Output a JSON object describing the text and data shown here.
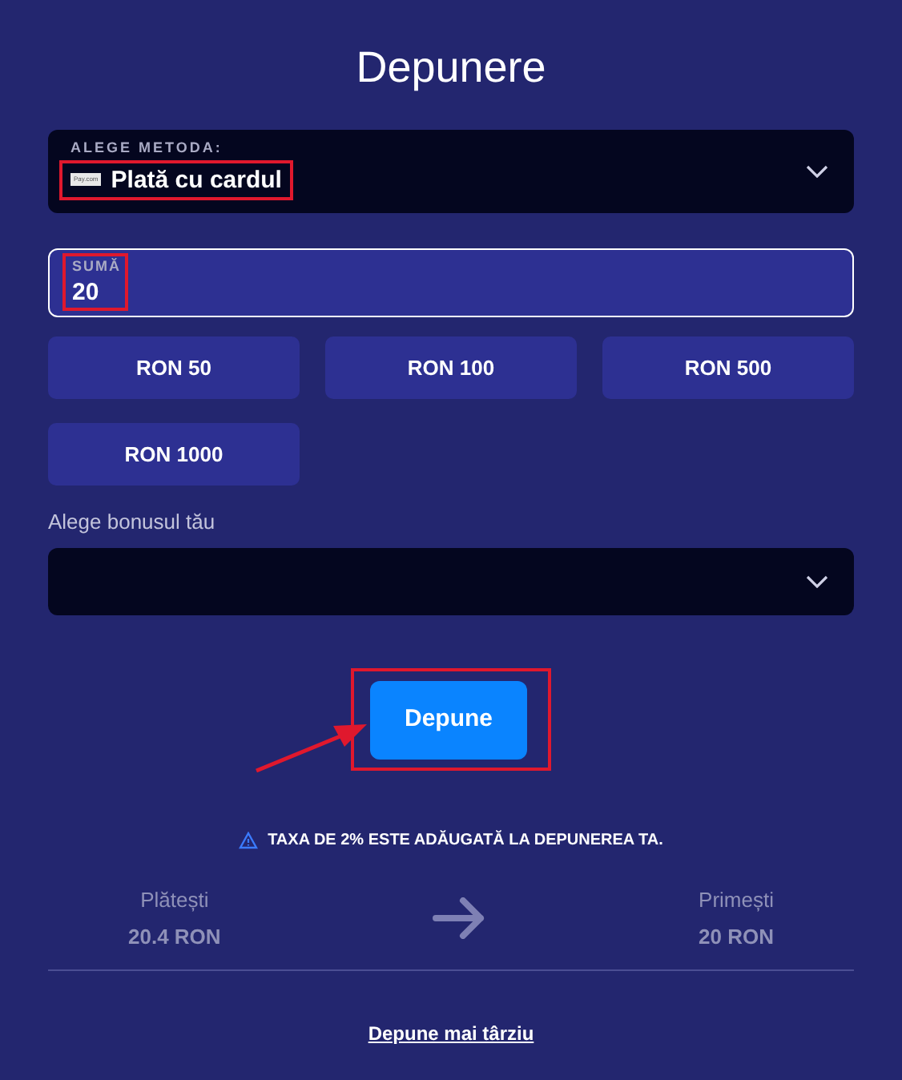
{
  "title": "Depunere",
  "method": {
    "label": "ALEGE METODA:",
    "logo": "Pay.com",
    "value": "Plată cu cardul"
  },
  "amount": {
    "label": "SUMĂ",
    "value": "20"
  },
  "presets": [
    {
      "label": "RON 50"
    },
    {
      "label": "RON 100"
    },
    {
      "label": "RON 500"
    },
    {
      "label": "RON 1000"
    }
  ],
  "bonus": {
    "label": "Alege bonusul tău"
  },
  "submit": "Depune",
  "notice": "TAXA DE 2% ESTE ADĂUGATĂ LA DEPUNEREA TA.",
  "summary": [
    {
      "label": "Plătești",
      "value": "20.4 RON"
    },
    {
      "label": "Primești",
      "value": "20 RON"
    }
  ],
  "later_link": "Depune mai târziu"
}
